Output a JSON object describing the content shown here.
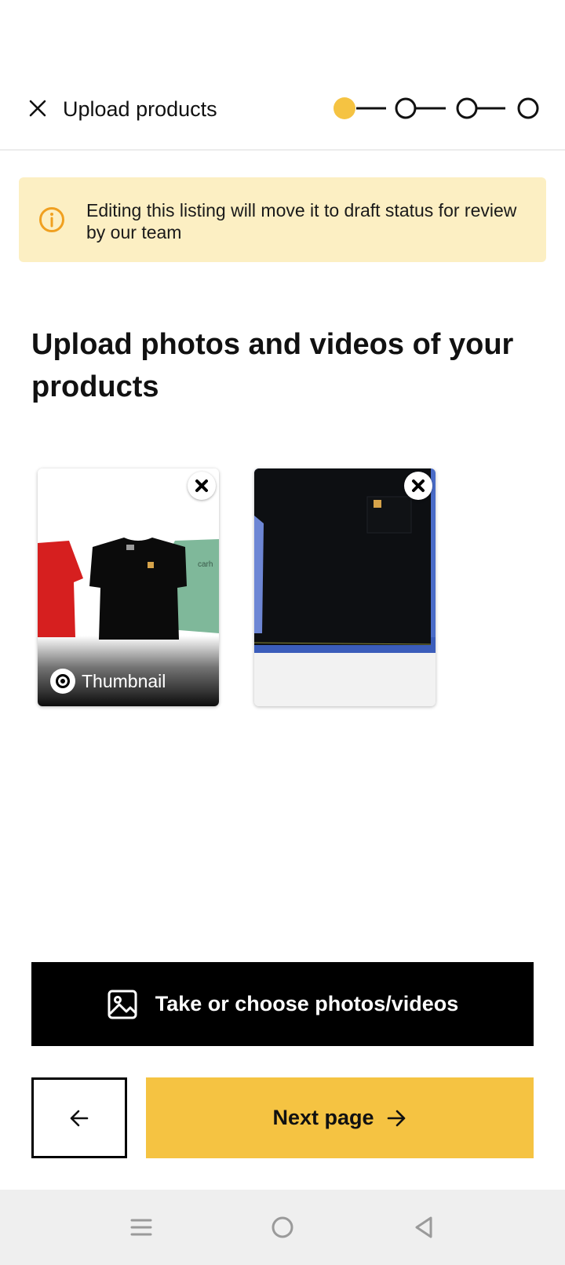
{
  "header": {
    "title": "Upload products",
    "close_icon": "close-icon",
    "stepper": {
      "total_steps": 4,
      "current_step": 1,
      "active_color": "#f5c342"
    }
  },
  "banner": {
    "text": "Editing this listing will move it to draft status for review by our team",
    "icon": "info-icon",
    "background": "#fcefc3",
    "icon_color": "#f0a020"
  },
  "main": {
    "heading": "Upload photos and videos of your products"
  },
  "photos": [
    {
      "thumbnail_label": "Thumbnail",
      "is_thumbnail": true,
      "remove_icon": "remove-icon"
    },
    {
      "is_thumbnail": false,
      "remove_icon": "remove-icon"
    }
  ],
  "actions": {
    "upload_label": "Take or choose photos/videos",
    "upload_icon": "image-icon",
    "back_icon": "arrow-left-icon",
    "next_label": "Next page",
    "next_icon": "arrow-right-icon",
    "next_color": "#f5c342"
  },
  "system_nav": {
    "items": [
      "menu-icon",
      "home-icon",
      "back-triangle-icon"
    ]
  }
}
